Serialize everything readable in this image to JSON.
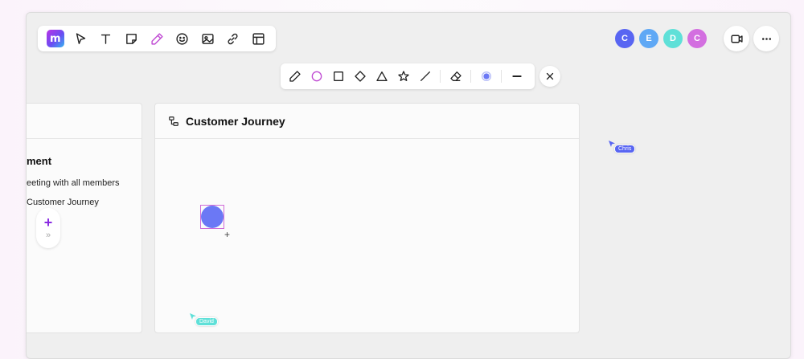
{
  "main_toolbar": {
    "logo_text": "m",
    "tools": [
      "select-tool",
      "text-tool",
      "sticky-note-tool",
      "pen-tool",
      "emoji-tool",
      "image-tool",
      "link-tool",
      "template-tool"
    ],
    "active_color": "#c04bd3"
  },
  "collaborators": [
    {
      "initial": "C",
      "color": "#5865f2"
    },
    {
      "initial": "E",
      "color": "#5fa8f5"
    },
    {
      "initial": "D",
      "color": "#5fe0d8"
    },
    {
      "initial": "C",
      "color": "#d36fe0"
    }
  ],
  "shape_toolbar": {
    "tools": [
      "pencil",
      "circle",
      "square",
      "diamond",
      "triangle",
      "star",
      "line",
      "eraser",
      "color",
      "stroke"
    ],
    "selected_color": "#6b78f5",
    "active_color": "#c04bd3"
  },
  "left_frame": {
    "title": "ment",
    "lines": [
      "eeting with all members",
      "Customer Journey"
    ]
  },
  "main_frame": {
    "title": "Customer Journey",
    "shape_color": "#6b78f5",
    "selection_color": "#d06ad8"
  },
  "cursors": [
    {
      "name": "Chris",
      "color": "#5865f2"
    },
    {
      "name": "David",
      "color": "#5fe0d8"
    }
  ]
}
